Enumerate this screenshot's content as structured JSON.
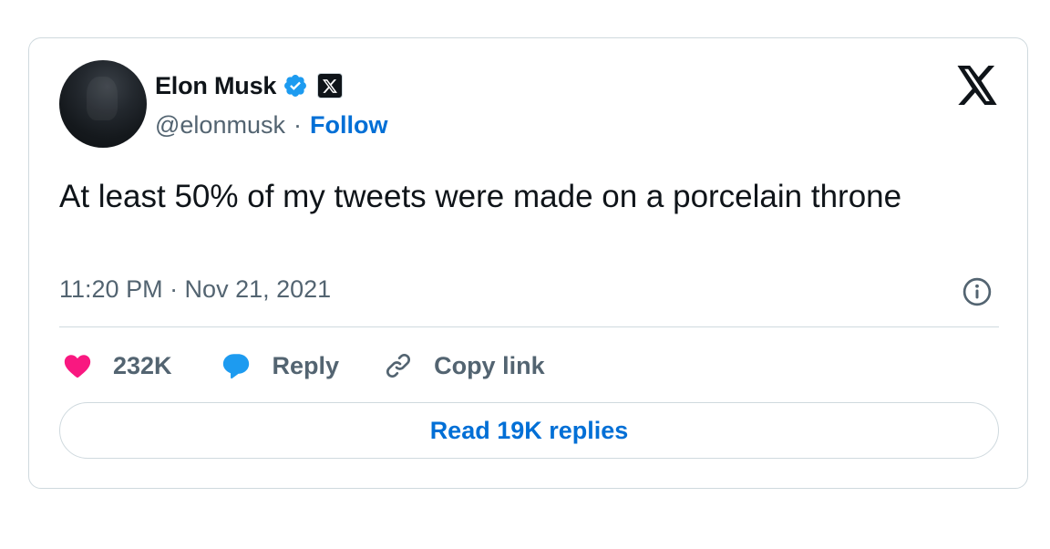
{
  "author": {
    "name": "Elon Musk",
    "handle": "@elonmusk",
    "separator": "·",
    "follow_label": "Follow",
    "verified_icon": "verified-badge-icon",
    "affiliate_icon": "x-affiliate-badge-icon"
  },
  "tweet": {
    "text": "At least 50% of my tweets were made on a porcelain throne",
    "timestamp": "11:20 PM · Nov 21, 2021"
  },
  "actions": {
    "like_count": "232K",
    "reply_label": "Reply",
    "copy_link_label": "Copy link"
  },
  "read_replies_label": "Read 19K replies",
  "colors": {
    "accent": "#006fd6",
    "verified": "#1d9bf0",
    "like": "#f91880",
    "reply": "#1d9bf0",
    "secondary_text": "#536471",
    "border": "#cfd9de"
  }
}
